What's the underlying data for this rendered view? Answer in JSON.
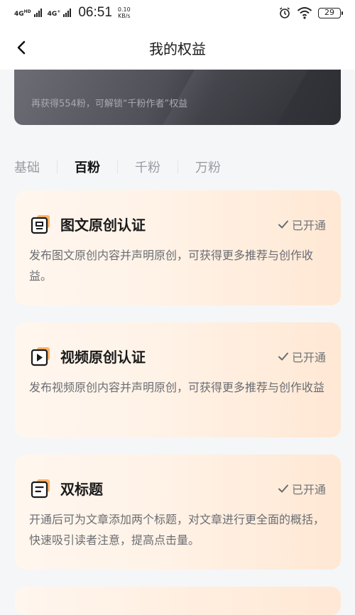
{
  "status_bar": {
    "network_1": "4G",
    "network_1_sup": "HD",
    "network_2": "4G",
    "network_2_sup": "+",
    "time": "06:51",
    "speed_value": "0.10",
    "speed_unit": "KB/s",
    "battery": "29",
    "icons": [
      "signal-icon",
      "alarm-icon",
      "wifi-icon",
      "battery-icon"
    ]
  },
  "header": {
    "title": "我的权益",
    "back_icon": "chevron-left-icon"
  },
  "hero": {
    "text": "再获得554粉，可解锁“千粉作者”权益"
  },
  "tabs": [
    {
      "label": "基础",
      "active": false
    },
    {
      "label": "百粉",
      "active": true
    },
    {
      "label": "千粉",
      "active": false
    },
    {
      "label": "万粉",
      "active": false
    }
  ],
  "benefits": [
    {
      "title": "图文原创认证",
      "status": "已开通",
      "description": "发布图文原创内容并声明原创，可获得更多推荐与创作收益。",
      "icon": "article-icon"
    },
    {
      "title": "视频原创认证",
      "status": "已开通",
      "description": "发布视频原创内容并声明原创，可获得更多推荐与创作收益",
      "icon": "video-icon"
    },
    {
      "title": "双标题",
      "status": "已开通",
      "description": "开通后可为文章添加两个标题，对文章进行更全面的概括，快速吸引读者注意，提高点击量。",
      "icon": "title-icon"
    }
  ],
  "colors": {
    "accent_orange": "#ff9a3c",
    "card_bg_start": "#fff6ee",
    "card_bg_end": "#ffe8d4",
    "hero_dark": "#2d2e34"
  }
}
